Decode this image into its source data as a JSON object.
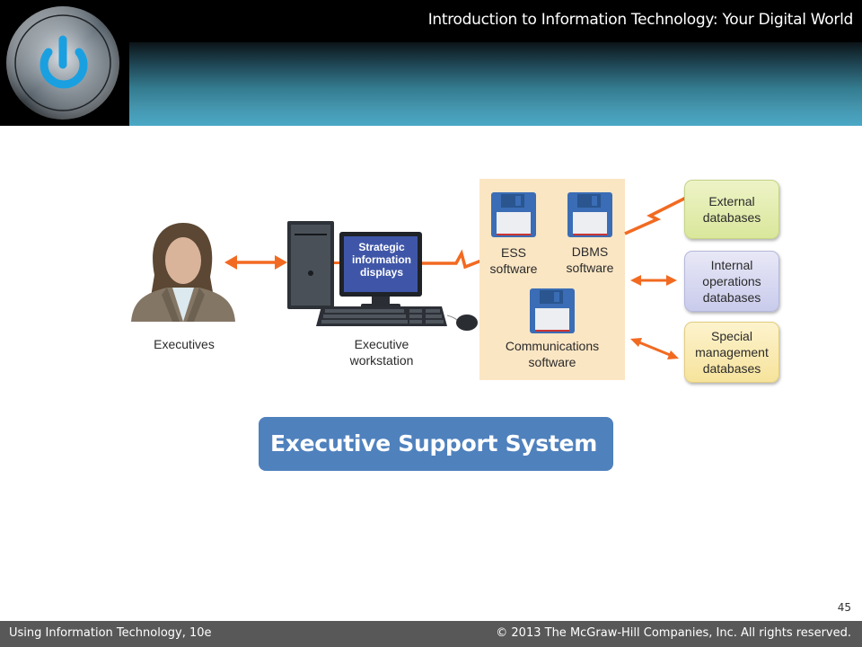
{
  "header": {
    "title": "Introduction to Information Technology: Your Digital World",
    "logo_icon": "power-button-icon"
  },
  "diagram": {
    "executives_label": "Executives",
    "workstation_label": "Executive workstation",
    "workstation_label_lines": [
      "Executive",
      "workstation"
    ],
    "screen_text_lines": [
      "Strategic",
      "information",
      "displays"
    ],
    "software": [
      {
        "name": "ESS",
        "line2": "software",
        "icon": "floppy-disk-icon"
      },
      {
        "name": "DBMS",
        "line2": "software",
        "icon": "floppy-disk-icon"
      },
      {
        "name": "Communications",
        "line2": "software",
        "icon": "floppy-disk-icon"
      }
    ],
    "databases": [
      {
        "lines": [
          "External",
          "databases"
        ],
        "color": "#d9e79b"
      },
      {
        "lines": [
          "Internal",
          "operations",
          "databases"
        ],
        "color": "#c9cbec"
      },
      {
        "lines": [
          "Special",
          "management",
          "databases"
        ],
        "color": "#f6e39c"
      }
    ],
    "connector_color": "#f26a21"
  },
  "slide": {
    "title": "Executive Support System",
    "page_number": "45"
  },
  "footer": {
    "left": "Using Information Technology, 10e",
    "right": "© 2013 The McGraw-Hill Companies, Inc. All rights reserved."
  }
}
